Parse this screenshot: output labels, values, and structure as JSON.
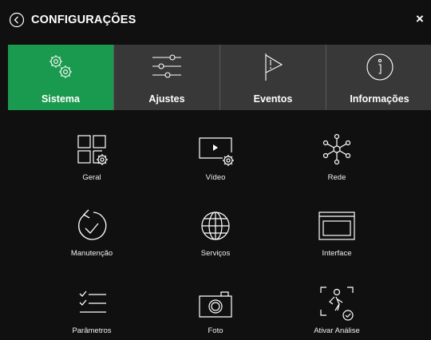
{
  "header": {
    "title": "CONFIGURAÇÕES",
    "close_glyph": "×"
  },
  "tabs": [
    {
      "label": "Sistema",
      "icon": "gears-icon",
      "active": true
    },
    {
      "label": "Ajustes",
      "icon": "sliders-icon",
      "active": false
    },
    {
      "label": "Eventos",
      "icon": "alert-flag-icon",
      "active": false
    },
    {
      "label": "Informações",
      "icon": "info-icon",
      "active": false
    }
  ],
  "items": [
    {
      "label": "Geral",
      "icon": "general-grid-icon"
    },
    {
      "label": "Vídeo",
      "icon": "video-settings-icon"
    },
    {
      "label": "Rede",
      "icon": "network-icon"
    },
    {
      "label": "Manutenção",
      "icon": "maintenance-restore-icon"
    },
    {
      "label": "Serviços",
      "icon": "globe-icon"
    },
    {
      "label": "Interface",
      "icon": "interface-window-icon"
    },
    {
      "label": "Parâmetros",
      "icon": "checklist-icon"
    },
    {
      "label": "Foto",
      "icon": "camera-icon"
    },
    {
      "label": "Ativar Análise",
      "icon": "person-analysis-icon"
    }
  ],
  "colors": {
    "accent": "#1a9a4e",
    "background": "#101010",
    "tab_background": "#383838"
  }
}
